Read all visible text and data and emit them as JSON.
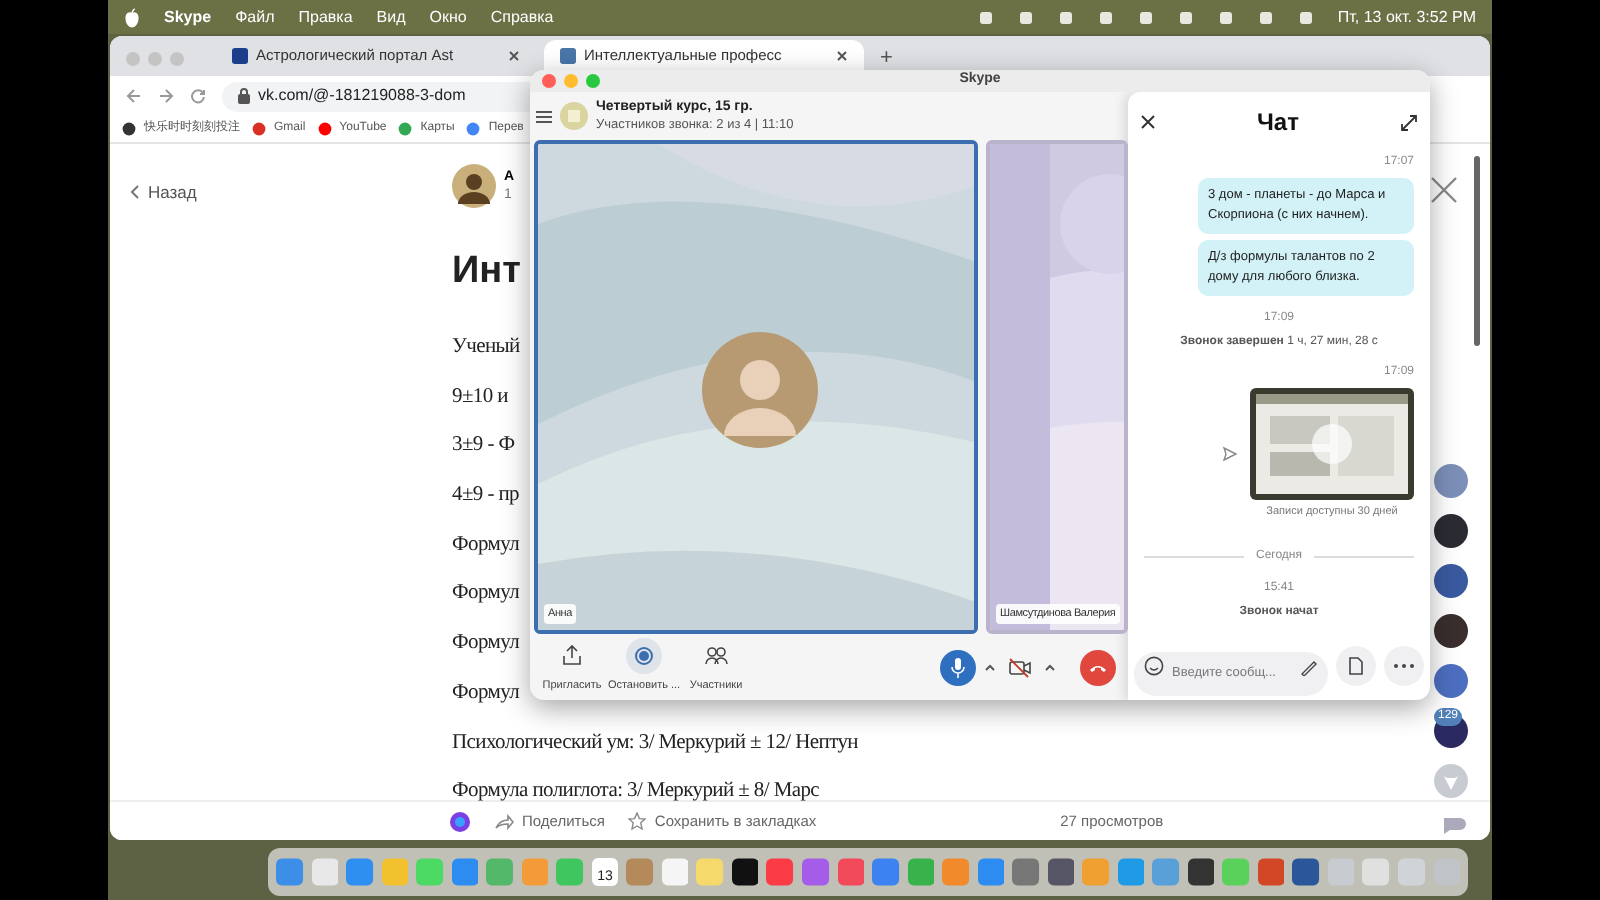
{
  "menu_bar": {
    "app": "Skype",
    "items": [
      "Файл",
      "Правка",
      "Вид",
      "Окно",
      "Справка"
    ],
    "clock": "Пт, 13 окт. 3:52 PM"
  },
  "browser": {
    "tabs": [
      {
        "title": "Астрологический портал Ast",
        "selected": false
      },
      {
        "title": "Интеллектуальные професс",
        "selected": true
      }
    ],
    "new_tab": "+",
    "address": "vk.com/@-181219088-3-dom",
    "bookmarks": [
      "快乐时时刻刻投注",
      "Gmail",
      "YouTube",
      "Карты",
      "Перев"
    ]
  },
  "article": {
    "back": "Назад",
    "author": "А",
    "author_meta": "1",
    "title": "Инт",
    "lines": [
      "Ученый",
      "9±10 и",
      "3±9 - Ф",
      "4±9 - пр",
      "Формул",
      "Формул",
      "Формул",
      "Формул",
      "Психологический ум: 3/ Меркурий ± 12/ Нептун",
      "Формула полиглота: 3/ Меркурий ± 8/ Марс"
    ]
  },
  "footer": {
    "share": "Поделиться",
    "bookmark": "Сохранить в закладках",
    "views": "27 просмотров"
  },
  "sidebar": {
    "badge": "129"
  },
  "skype": {
    "title": "Skype",
    "conversation": "Четвертый курс, 15 гр.",
    "participants": "Участников звонка: 2 из 4 | 11:10",
    "tiles": [
      {
        "name": "Анна",
        "kind": "avatar",
        "selected": true
      },
      {
        "name": "Шамсутдинова Валерия",
        "kind": "video",
        "selected": false
      }
    ],
    "controls": [
      {
        "label": "Пригласить",
        "kind": "share",
        "selected": false
      },
      {
        "label": "Остановить ...",
        "kind": "record",
        "selected": true
      },
      {
        "label": "Участники",
        "kind": "people",
        "selected": false
      }
    ],
    "mic_on": true,
    "camera_on": false
  },
  "chat": {
    "title": "Чат",
    "messages": [
      {
        "kind": "time",
        "text": "17:07"
      },
      {
        "kind": "bubble",
        "text": "3 дом - планеты - до Марса и Скорпиона (с них начнем)."
      },
      {
        "kind": "bubble",
        "text": "Д/з формулы талантов по 2 дому для любого близка."
      },
      {
        "kind": "center_time",
        "text": "17:09"
      },
      {
        "kind": "event",
        "text": "**Звонок завершен** 1 ч, 27 мин, 28 с"
      },
      {
        "kind": "time",
        "text": "17:09"
      },
      {
        "kind": "video",
        "text": "Записи доступны 30 дней"
      },
      {
        "kind": "divider",
        "text": "Сегодня"
      },
      {
        "kind": "center_time",
        "text": "15:41"
      },
      {
        "kind": "event_bold",
        "text": "Звонок начат"
      }
    ],
    "placeholder": "Введите сообщ..."
  },
  "dock": {
    "calendar_day": "13"
  }
}
